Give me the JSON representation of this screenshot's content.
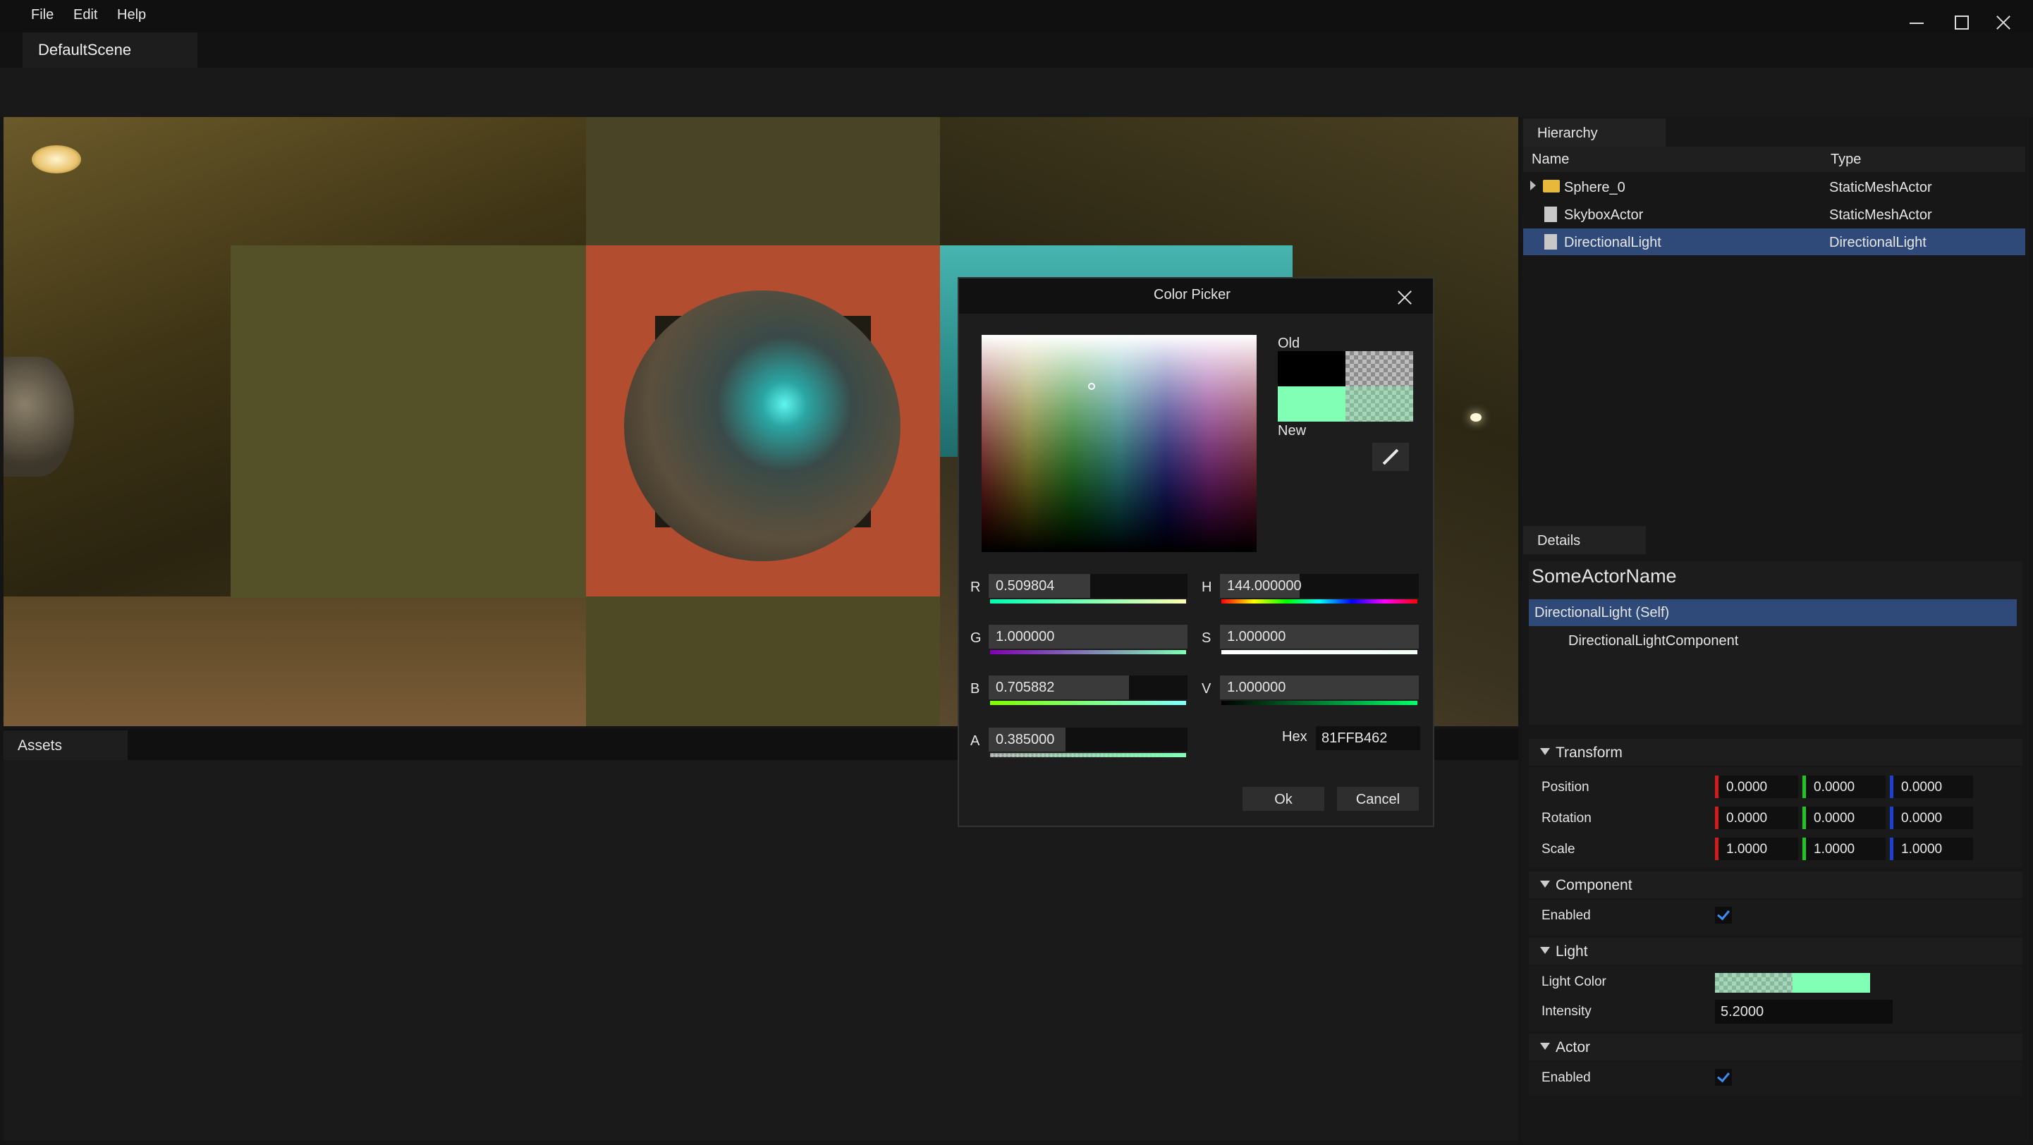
{
  "menu": [
    "File",
    "Edit",
    "Help"
  ],
  "scene_tab": "DefaultScene",
  "assets_tab": "Assets",
  "hierarchy": {
    "tab": "Hierarchy",
    "col_name": "Name",
    "col_type": "Type",
    "rows": [
      {
        "name": "Sphere_0",
        "type": "StaticMeshActor",
        "icon": "folder-icon"
      },
      {
        "name": "SkyboxActor",
        "type": "StaticMeshActor",
        "icon": "file-icon"
      },
      {
        "name": "DirectionalLight",
        "type": "DirectionalLight",
        "icon": "file-icon",
        "selected": true
      }
    ]
  },
  "details": {
    "tab": "Details",
    "actor_name": "SomeActorName",
    "components": [
      "DirectionalLight (Self)",
      "DirectionalLightComponent"
    ],
    "transform": {
      "title": "Transform",
      "position_label": "Position",
      "rotation_label": "Rotation",
      "scale_label": "Scale",
      "position": [
        "0.0000",
        "0.0000",
        "0.0000"
      ],
      "rotation": [
        "0.0000",
        "0.0000",
        "0.0000"
      ],
      "scale": [
        "1.0000",
        "1.0000",
        "1.0000"
      ]
    },
    "component": {
      "title": "Component",
      "enabled_label": "Enabled",
      "enabled": true
    },
    "light": {
      "title": "Light",
      "color_label": "Light Color",
      "intensity_label": "Intensity",
      "intensity": "5.2000"
    },
    "actor": {
      "title": "Actor",
      "enabled_label": "Enabled",
      "enabled": true
    }
  },
  "color_picker": {
    "title": "Color Picker",
    "old_label": "Old",
    "new_label": "New",
    "channels": {
      "r": {
        "label": "R",
        "value": "0.509804",
        "fraction": 0.509804
      },
      "g": {
        "label": "G",
        "value": "1.000000",
        "fraction": 1.0
      },
      "b": {
        "label": "B",
        "value": "0.705882",
        "fraction": 0.705882
      },
      "a": {
        "label": "A",
        "value": "0.385000",
        "fraction": 0.385
      },
      "h": {
        "label": "H",
        "value": "144.000000",
        "fraction": 0.4
      },
      "s": {
        "label": "S",
        "value": "1.000000",
        "fraction": 1.0
      },
      "v": {
        "label": "V",
        "value": "1.000000",
        "fraction": 1.0
      }
    },
    "hex_label": "Hex",
    "hex": "81FFB462",
    "ok_label": "Ok",
    "cancel_label": "Cancel"
  },
  "colors": {
    "new_color": "#81FFB4",
    "old_color": "#000000",
    "selection": "#2f4a78",
    "axis_x": "#d11a1a",
    "axis_y": "#22c322",
    "axis_z": "#1e3fd6"
  }
}
